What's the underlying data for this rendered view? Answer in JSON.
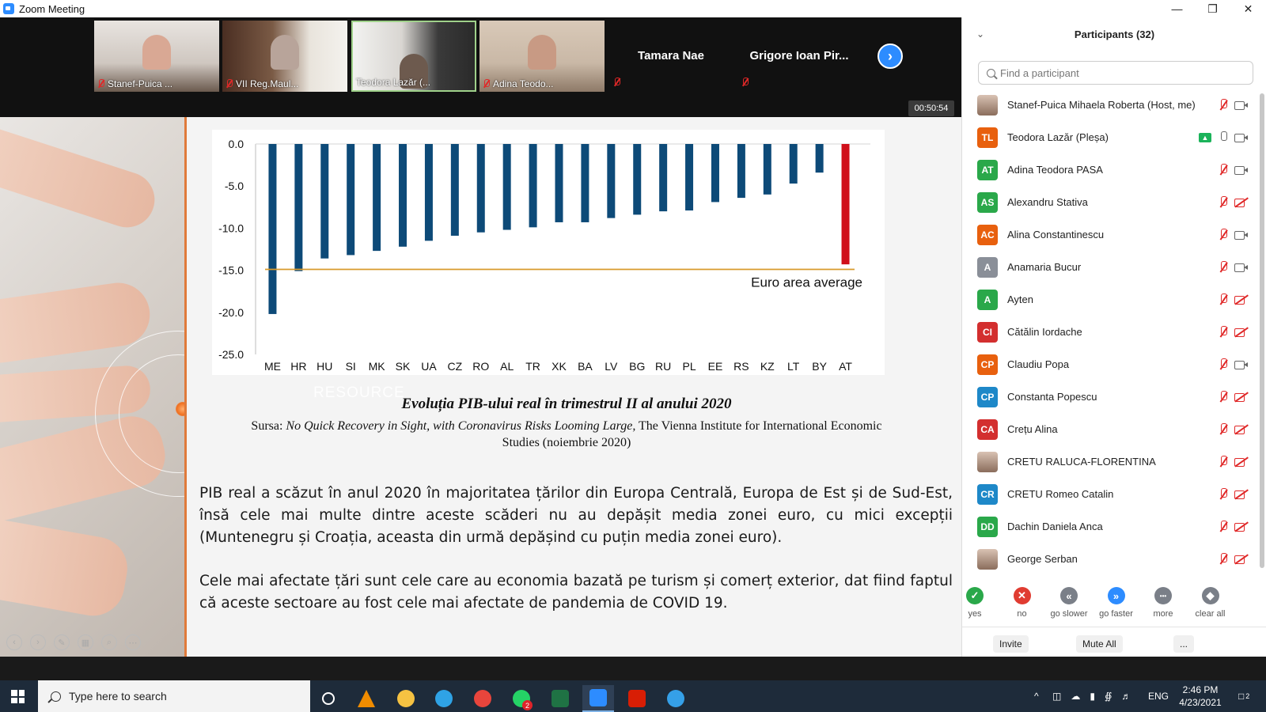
{
  "window": {
    "title": "Zoom Meeting",
    "controls": [
      "—",
      "❐",
      "✕"
    ]
  },
  "gallery": {
    "video_tiles": [
      {
        "label": "Stanef-Puica ..."
      },
      {
        "label": "VII Reg.Maul..."
      },
      {
        "label": "Teodora Lazăr (..."
      },
      {
        "label": "Adina Teodo..."
      }
    ],
    "name_tiles": [
      {
        "name": "Tamara Nae"
      },
      {
        "name": "Grigore Ioan Pir..."
      }
    ],
    "next_symbol": "›",
    "timer": "00:50:54"
  },
  "slide": {
    "watermark": "RESOURCE",
    "caption": "Evoluția PIB-ului real în trimestrul II al anului 2020",
    "source_prefix": "Sursa: ",
    "source_title": "No Quick Recovery in Sight, with Coronavirus Risks Looming Large,",
    "source_rest": " The Vienna Institute for International Economic Studies (noiembrie 2020)",
    "paragraph1": "PIB real a scăzut în anul 2020 în majoritatea țărilor din Europa Centrală, Europa de Est și de Sud-Est, însă cele mai multe dintre aceste scăderi nu au depășit media zonei euro, cu mici excepții (Muntenegru și Croația, aceasta din urmă depășind cu puțin media zonei euro).",
    "paragraph2": "Cele mai afectate țări sunt cele care au economia bazată pe turism și comerț exterior, dat fiind faptul că aceste sectoare au fost cele mai afectate de pandemia de COVID 19.",
    "tools": [
      "‹",
      "›",
      "✎",
      "▦",
      "⌕",
      "⋯"
    ]
  },
  "chart_data": {
    "type": "bar",
    "title": "",
    "categories": [
      "ME",
      "HR",
      "HU",
      "SI",
      "MK",
      "SK",
      "UA",
      "CZ",
      "RO",
      "AL",
      "TR",
      "XK",
      "BA",
      "LV",
      "BG",
      "RU",
      "PL",
      "EE",
      "RS",
      "KZ",
      "LT",
      "BY",
      "AT"
    ],
    "values": [
      -20.2,
      -15.1,
      -13.6,
      -13.2,
      -12.7,
      -12.2,
      -11.5,
      -10.9,
      -10.5,
      -10.2,
      -9.9,
      -9.3,
      -9.3,
      -8.8,
      -8.4,
      -8.0,
      -7.9,
      -6.9,
      -6.4,
      -6.0,
      -4.7,
      -3.4,
      -14.3
    ],
    "highlight_color": "#d0101b",
    "bar_color": "#0d4a78",
    "reference_line": {
      "value": -14.9,
      "label": "Euro area average",
      "color": "#d99a2b"
    },
    "yticks": [
      "0.0",
      "-5.0",
      "-10.0",
      "-15.0",
      "-20.0",
      "-25.0"
    ],
    "ylim": [
      -25,
      0
    ],
    "xlabel": "",
    "ylabel": ""
  },
  "participants": {
    "title": "Participants (32)",
    "search_placeholder": "Find a participant",
    "list": [
      {
        "initials": "",
        "name": "Stanef-Puica Mihaela Roberta (Host, me)",
        "color": "",
        "photo": true,
        "mic": "off",
        "cam": "on"
      },
      {
        "initials": "TL",
        "name": "Teodora Lazăr (Pleșa)",
        "color": "#e8600e",
        "photo": false,
        "mic": "on",
        "cam": "on",
        "sharing": true
      },
      {
        "initials": "AT",
        "name": "Adina Teodora PASA",
        "color": "#2aa84a",
        "photo": false,
        "mic": "off",
        "cam": "on"
      },
      {
        "initials": "AS",
        "name": "Alexandru Stativa",
        "color": "#2aa84a",
        "photo": false,
        "mic": "off",
        "cam": "off"
      },
      {
        "initials": "AC",
        "name": "Alina Constantinescu",
        "color": "#e8600e",
        "photo": false,
        "mic": "off",
        "cam": "on"
      },
      {
        "initials": "A",
        "name": "Anamaria Bucur",
        "color": "#8a8f98",
        "photo": false,
        "mic": "off",
        "cam": "on"
      },
      {
        "initials": "A",
        "name": "Ayten",
        "color": "#2aa84a",
        "photo": false,
        "mic": "off",
        "cam": "off"
      },
      {
        "initials": "CI",
        "name": "Cătălin Iordache",
        "color": "#d32f2f",
        "photo": false,
        "mic": "off",
        "cam": "off"
      },
      {
        "initials": "CP",
        "name": "Claudiu Popa",
        "color": "#e8600e",
        "photo": false,
        "mic": "off",
        "cam": "on"
      },
      {
        "initials": "CP",
        "name": "Constanta Popescu",
        "color": "#1e88c8",
        "photo": false,
        "mic": "off",
        "cam": "off"
      },
      {
        "initials": "CA",
        "name": "Crețu Alina",
        "color": "#d32f2f",
        "photo": false,
        "mic": "off",
        "cam": "off"
      },
      {
        "initials": "",
        "name": "CRETU RALUCA-FLORENTINA",
        "color": "",
        "photo": true,
        "mic": "off",
        "cam": "off"
      },
      {
        "initials": "CR",
        "name": "CRETU Romeo Catalin",
        "color": "#1e88c8",
        "photo": false,
        "mic": "off",
        "cam": "off"
      },
      {
        "initials": "DD",
        "name": "Dachin Daniela Anca",
        "color": "#2aa84a",
        "photo": false,
        "mic": "off",
        "cam": "off"
      },
      {
        "initials": "",
        "name": "George Serban",
        "color": "",
        "photo": true,
        "mic": "off",
        "cam": "off"
      }
    ],
    "reactions": [
      {
        "label": "yes",
        "symbol": "✓",
        "color": "#2aa84a"
      },
      {
        "label": "no",
        "symbol": "✕",
        "color": "#e03c31"
      },
      {
        "label": "go slower",
        "symbol": "«",
        "color": "#7a7f88"
      },
      {
        "label": "go faster",
        "symbol": "»",
        "color": "#2d8cff"
      },
      {
        "label": "more",
        "symbol": "•••",
        "color": "#7a7f88"
      },
      {
        "label": "clear all",
        "symbol": "◆",
        "color": "#7a7f88"
      }
    ],
    "footer": {
      "invite": "Invite",
      "mute_all": "Mute All",
      "more": "..."
    }
  },
  "taskbar": {
    "search_text": "Type here to search",
    "apps": [
      {
        "name": "cortana-icon",
        "color": "#ffffff"
      },
      {
        "name": "vlc-icon",
        "color": "#f08c00"
      },
      {
        "name": "file-explorer-icon",
        "color": "#f5c242"
      },
      {
        "name": "edge-icon",
        "color": "#2fa3e6"
      },
      {
        "name": "chrome-icon",
        "color": "#e8453c"
      },
      {
        "name": "whatsapp-icon",
        "color": "#25d366"
      },
      {
        "name": "excel-icon",
        "color": "#1f7244"
      },
      {
        "name": "zoom-icon",
        "color": "#2d8cff"
      },
      {
        "name": "acrobat-icon",
        "color": "#d81e05"
      },
      {
        "name": "paint-icon",
        "color": "#35a0e8"
      }
    ],
    "whatsapp_badge": "2",
    "tray": {
      "chevron": "^",
      "lang": "ENG",
      "time": "2:46 PM",
      "date": "4/23/2021",
      "notifications": "2"
    }
  }
}
